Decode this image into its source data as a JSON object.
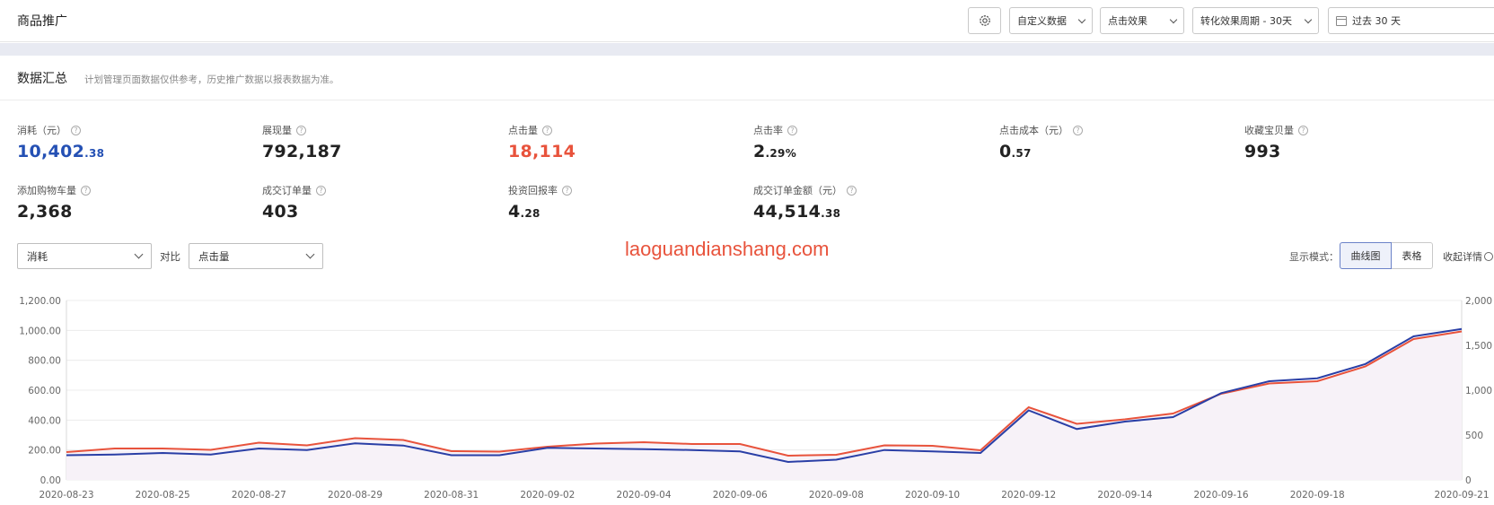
{
  "header": {
    "title": "商品推广",
    "custom_data_label": "自定义数据",
    "click_effect_label": "点击效果",
    "conversion_period_label": "转化效果周期 - 30天",
    "date_range_label": "过去 30 天"
  },
  "summary": {
    "title": "数据汇总",
    "note": "计划管理页面数据仅供参考，历史推广数据以报表数据为准。"
  },
  "metrics": [
    {
      "label": "消耗（元）",
      "int": "10,402",
      "dec": ".38"
    },
    {
      "label": "展现量",
      "int": "792,187",
      "dec": ""
    },
    {
      "label": "点击量",
      "int": "18,114",
      "dec": ""
    },
    {
      "label": "点击率",
      "int": "2",
      "dec": ".29%"
    },
    {
      "label": "点击成本（元）",
      "int": "0",
      "dec": ".57"
    },
    {
      "label": "收藏宝贝量",
      "int": "993",
      "dec": ""
    },
    {
      "label": "添加购物车量",
      "int": "2,368",
      "dec": ""
    },
    {
      "label": "成交订单量",
      "int": "403",
      "dec": ""
    },
    {
      "label": "投资回报率",
      "int": "4",
      "dec": ".28"
    },
    {
      "label": "成交订单金额（元）",
      "int": "44,514",
      "dec": ".38"
    }
  ],
  "controls": {
    "metric_a": "消耗",
    "compare_label": "对比",
    "metric_b": "点击量",
    "display_mode_label": "显示模式：",
    "mode_curve": "曲线图",
    "mode_table": "表格",
    "collapse_label": "收起详情"
  },
  "watermark": "laoguandianshang.com",
  "colors": {
    "spend_line": "#2a3fa6",
    "clicks_line": "#e8533c",
    "area_fill": "#f7f2f8",
    "accent_blue": "#2450b4",
    "accent_red": "#e8533c"
  },
  "chart_data": {
    "type": "line",
    "x": [
      "2020-08-23",
      "2020-08-24",
      "2020-08-25",
      "2020-08-26",
      "2020-08-27",
      "2020-08-28",
      "2020-08-29",
      "2020-08-30",
      "2020-08-31",
      "2020-09-01",
      "2020-09-02",
      "2020-09-03",
      "2020-09-04",
      "2020-09-05",
      "2020-09-06",
      "2020-09-07",
      "2020-09-08",
      "2020-09-09",
      "2020-09-10",
      "2020-09-11",
      "2020-09-12",
      "2020-09-13",
      "2020-09-14",
      "2020-09-15",
      "2020-09-16",
      "2020-09-17",
      "2020-09-18",
      "2020-09-19",
      "2020-09-20",
      "2020-09-21"
    ],
    "x_tick_labels": [
      "2020-08-23",
      "2020-08-25",
      "2020-08-27",
      "2020-08-29",
      "2020-08-31",
      "2020-09-02",
      "2020-09-04",
      "2020-09-06",
      "2020-09-08",
      "2020-09-10",
      "2020-09-12",
      "2020-09-14",
      "2020-09-16",
      "2020-09-18",
      "2020-09-21"
    ],
    "y_ticks": [
      "0.00",
      "200.00",
      "400.00",
      "600.00",
      "800.00",
      "1,000.00",
      "1,200.00"
    ],
    "y2_ticks": [
      "0",
      "500",
      "1,000",
      "1,500",
      "2,000"
    ],
    "ylim": [
      0,
      1200
    ],
    "y2lim": [
      0,
      2000
    ],
    "grid": true,
    "series": [
      {
        "name": "消耗",
        "axis": "left",
        "values": [
          165,
          170,
          180,
          170,
          210,
          200,
          245,
          230,
          165,
          165,
          215,
          210,
          205,
          200,
          190,
          120,
          135,
          200,
          190,
          180,
          465,
          340,
          390,
          420,
          580,
          660,
          680,
          775,
          960,
          1010
        ]
      },
      {
        "name": "点击量",
        "axis": "right",
        "values": [
          310,
          350,
          350,
          335,
          415,
          385,
          465,
          445,
          320,
          315,
          370,
          405,
          420,
          400,
          400,
          270,
          280,
          385,
          380,
          330,
          810,
          625,
          675,
          740,
          960,
          1075,
          1100,
          1265,
          1570,
          1655
        ]
      }
    ]
  }
}
